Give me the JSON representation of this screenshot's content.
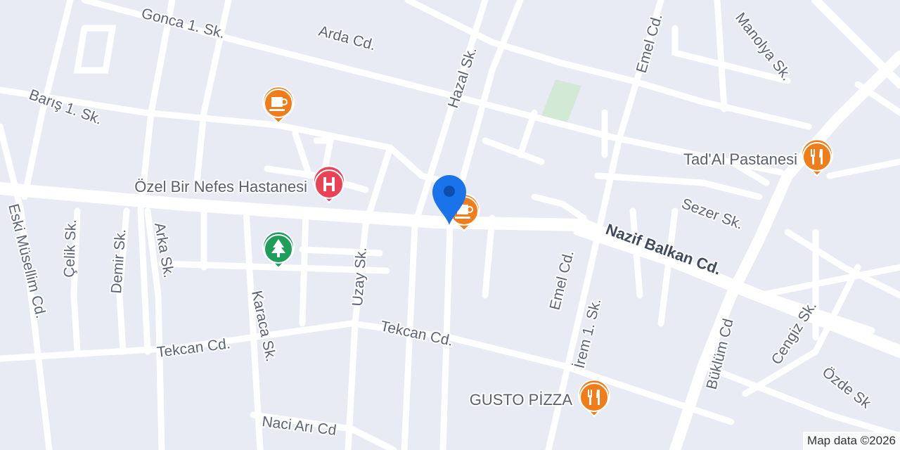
{
  "map": {
    "streets": {
      "gonca": "Gonca 1. Sk.",
      "arda": "Arda Cd.",
      "hazal": "Hazal Sk.",
      "emel_top": "Emel Cd.",
      "manolya": "Manolya Sk.",
      "baris": "Barış 1. Sk.",
      "sezer": "Sezer Sk.",
      "nazif": "Nazif Balkan Cd.",
      "eski": "Eski Müsellim Cd.",
      "celik": "Çelik Sk.",
      "demir": "Demir Sk.",
      "arka": "Arka Sk.",
      "karaca": "Karaca Sk.",
      "uzay": "Uzay Sk.",
      "emel_bottom": "Emel Cd.",
      "irem": "İrem 1. Sk.",
      "buklum": "Büklüm Cd",
      "cengiz": "Cengiz Sk.",
      "ozde": "Özde Sk",
      "tekcan_left": "Tekcan Cd.",
      "tekcan_right": "Tekcan Cd.",
      "naci": "Naci Arı Cd"
    },
    "pois": {
      "hospital": {
        "name": "Özel Bir Nefes Hastanesi",
        "icon": "hospital-icon",
        "color": "#ea4356"
      },
      "cafe_top": {
        "icon": "coffee-cup-icon",
        "color": "#f07d1a"
      },
      "cafe_center": {
        "icon": "coffee-cup-icon",
        "color": "#f07d1a"
      },
      "tadal": {
        "name": "Tad'Al Pastanesi",
        "icon": "restaurant-icon",
        "color": "#f07d1a"
      },
      "gusto": {
        "name": "GUSTO PİZZA",
        "icon": "restaurant-icon",
        "color": "#f07d1a"
      },
      "park": {
        "icon": "tree-icon",
        "color": "#1e9e5a"
      }
    },
    "location_pin": {
      "icon": "location-pin-icon",
      "color": "#1a73e8"
    },
    "attribution": "Map data ©2026"
  }
}
